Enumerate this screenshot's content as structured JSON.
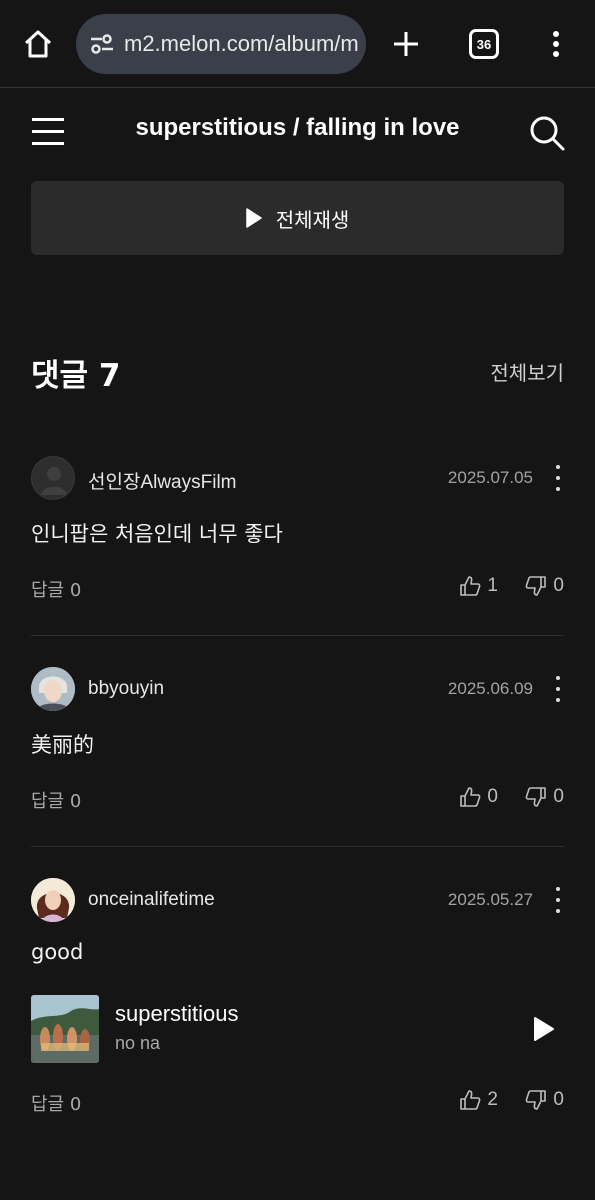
{
  "browser": {
    "url": "m2.melon.com/album/m",
    "tab_count": "36",
    "icons": [
      "home-icon",
      "site-settings-icon",
      "new-tab-icon",
      "tab-switcher-icon",
      "more-vert-icon"
    ]
  },
  "header": {
    "title": "superstitious / falling in love",
    "icons": [
      "menu-icon",
      "search-icon"
    ]
  },
  "play_all": {
    "label": "전체재생",
    "icon": "play-icon"
  },
  "comments_section": {
    "title": "댓글 7",
    "view_all": "전체보기"
  },
  "comments": [
    {
      "username": "선인장AlwaysFilm",
      "date": "2025.07.05",
      "text": "인니팝은 처음인데 너무 좋다",
      "reply_label": "답글 0",
      "likes": "1",
      "dislikes": "0"
    },
    {
      "username": "bbyouyin",
      "date": "2025.06.09",
      "text": "美丽的",
      "reply_label": "답글 0",
      "likes": "0",
      "dislikes": "0"
    },
    {
      "username": "onceinalifetime",
      "date": "2025.05.27",
      "text": "good",
      "song": {
        "title": "superstitious",
        "artist": "no na"
      },
      "reply_label": "답글 0",
      "likes": "2",
      "dislikes": "0"
    }
  ],
  "colors": {
    "background": "#151515",
    "url_pill": "#3b3f49",
    "button_bg": "#2b2b2b",
    "divider": "#2c2c2c",
    "muted_text": "#a8a8a8"
  }
}
